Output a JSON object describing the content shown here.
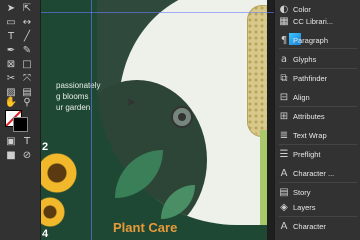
{
  "canvas": {
    "promo_lines": [
      "passionately",
      "g blooms",
      "ur garden"
    ],
    "title": "Plant Care",
    "numbers": [
      "2",
      "4"
    ]
  },
  "panels": [
    {
      "label": "Color",
      "icon": "color-icon"
    },
    {
      "label": "CC Librari...",
      "icon": "cc-libraries-icon"
    },
    {
      "label": "Paragraph",
      "icon": "paragraph-icon"
    },
    {
      "label": "Glyphs",
      "icon": "glyphs-icon"
    },
    {
      "label": "Pathfinder",
      "icon": "pathfinder-icon"
    },
    {
      "label": "Align",
      "icon": "align-icon"
    },
    {
      "label": "Attributes",
      "icon": "attributes-icon"
    },
    {
      "label": "Text Wrap",
      "icon": "text-wrap-icon"
    },
    {
      "label": "Preflight",
      "icon": "preflight-icon"
    },
    {
      "label": "Character ...",
      "icon": "character-styles-icon"
    },
    {
      "label": "Story",
      "icon": "story-icon"
    },
    {
      "label": "Layers",
      "icon": "layers-icon"
    },
    {
      "label": "Character",
      "icon": "character-icon"
    }
  ],
  "colors": {
    "accent_title": "#e79a3a",
    "doc_background": "#1f4834",
    "panel_background": "#323232"
  }
}
